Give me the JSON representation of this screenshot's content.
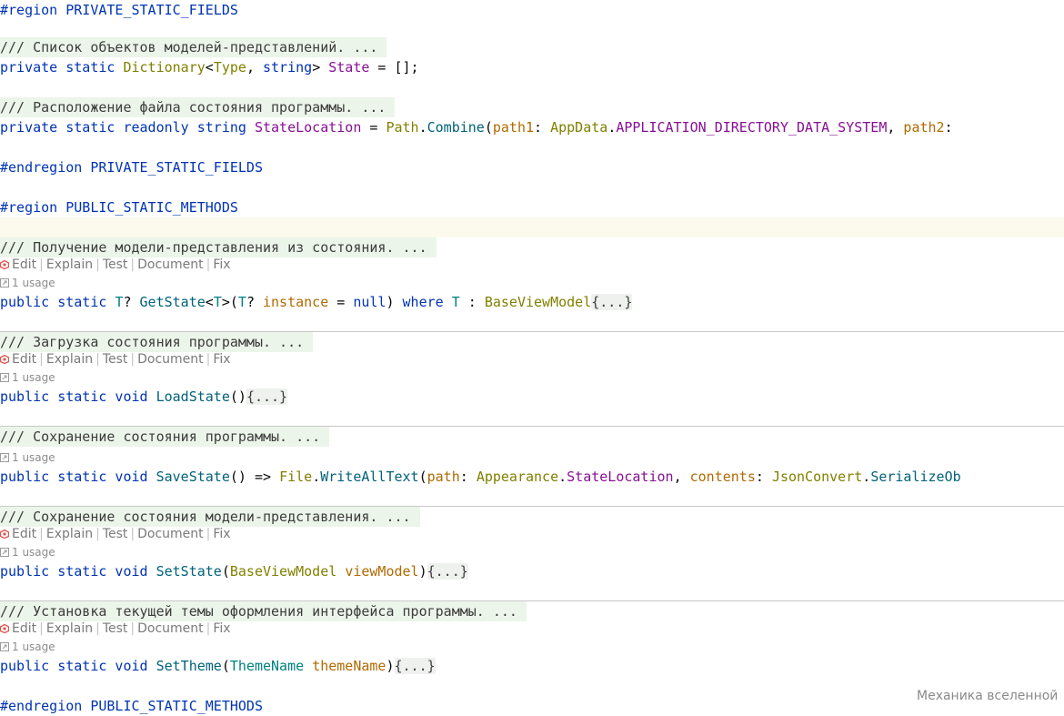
{
  "region_private": {
    "start": "#region PRIVATE_STATIC_FIELDS",
    "end": "#endregion PRIVATE_STATIC_FIELDS"
  },
  "region_public": {
    "start": "#region PUBLIC_STATIC_METHODS",
    "end": "#endregion PUBLIC_STATIC_METHODS"
  },
  "fields": [
    {
      "doc": "/// Список объектов моделей-представлений. ...",
      "tokens": [
        {
          "t": "private static ",
          "c": "kw"
        },
        {
          "t": "Dictionary",
          "c": "ty"
        },
        {
          "t": "<",
          "c": ""
        },
        {
          "t": "Type",
          "c": "ty"
        },
        {
          "t": ", ",
          "c": ""
        },
        {
          "t": "string",
          "c": "kw"
        },
        {
          "t": "> ",
          "c": ""
        },
        {
          "t": "State",
          "c": "fld"
        },
        {
          "t": " = [];",
          "c": ""
        }
      ]
    },
    {
      "doc": "/// Расположение файла состояния программы. ...",
      "tokens": [
        {
          "t": "private static readonly string ",
          "c": "kw"
        },
        {
          "t": "StateLocation",
          "c": "fld"
        },
        {
          "t": " = ",
          "c": ""
        },
        {
          "t": "Path",
          "c": "ty"
        },
        {
          "t": ".",
          "c": ""
        },
        {
          "t": "Combine",
          "c": "m"
        },
        {
          "t": "(",
          "c": ""
        },
        {
          "t": "path1",
          "c": "p"
        },
        {
          "t": ": ",
          "c": ""
        },
        {
          "t": "AppData",
          "c": "ty"
        },
        {
          "t": ".",
          "c": ""
        },
        {
          "t": "APPLICATION_DIRECTORY_DATA_SYSTEM",
          "c": "fld"
        },
        {
          "t": ", ",
          "c": ""
        },
        {
          "t": "path2",
          "c": "p"
        },
        {
          "t": ":",
          "c": ""
        }
      ]
    }
  ],
  "ai_actions": {
    "edit": "Edit",
    "explain": "Explain",
    "test": "Test",
    "document": "Document",
    "fix": "Fix"
  },
  "methods": [
    {
      "doc": "/// Получение модели-представления из состояния. ...",
      "actions": true,
      "usage": "1 usage",
      "tokens": [
        {
          "t": "public static ",
          "c": "kw"
        },
        {
          "t": "T",
          "c": "tp"
        },
        {
          "t": "? ",
          "c": ""
        },
        {
          "t": "GetState",
          "c": "m"
        },
        {
          "t": "<",
          "c": ""
        },
        {
          "t": "T",
          "c": "tp"
        },
        {
          "t": ">(",
          "c": ""
        },
        {
          "t": "T",
          "c": "tp"
        },
        {
          "t": "? ",
          "c": ""
        },
        {
          "t": "instance",
          "c": "p"
        },
        {
          "t": " = ",
          "c": ""
        },
        {
          "t": "null",
          "c": "kw"
        },
        {
          "t": ") ",
          "c": ""
        },
        {
          "t": "where ",
          "c": "kw"
        },
        {
          "t": "T",
          "c": "tp"
        },
        {
          "t": " : ",
          "c": ""
        },
        {
          "t": "BaseViewModel",
          "c": "ty"
        },
        {
          "t": "{...}",
          "c": "fold"
        }
      ]
    },
    {
      "doc": "/// Загрузка состояния программы. ...",
      "actions": true,
      "usage": "1 usage",
      "tokens": [
        {
          "t": "public static void ",
          "c": "kw"
        },
        {
          "t": "LoadState",
          "c": "m"
        },
        {
          "t": "()",
          "c": ""
        },
        {
          "t": "{...}",
          "c": "fold"
        }
      ]
    },
    {
      "doc": "/// Сохранение состояния программы. ...",
      "actions": false,
      "usage": "1 usage",
      "tokens": [
        {
          "t": "public static void ",
          "c": "kw"
        },
        {
          "t": "SaveState",
          "c": "m"
        },
        {
          "t": "() => ",
          "c": ""
        },
        {
          "t": "File",
          "c": "ty"
        },
        {
          "t": ".",
          "c": ""
        },
        {
          "t": "WriteAllText",
          "c": "m"
        },
        {
          "t": "(",
          "c": ""
        },
        {
          "t": "path",
          "c": "p"
        },
        {
          "t": ": ",
          "c": ""
        },
        {
          "t": "Appearance",
          "c": "ty"
        },
        {
          "t": ".",
          "c": ""
        },
        {
          "t": "StateLocation",
          "c": "fld"
        },
        {
          "t": ", ",
          "c": ""
        },
        {
          "t": "contents",
          "c": "p"
        },
        {
          "t": ": ",
          "c": ""
        },
        {
          "t": "JsonConvert",
          "c": "ty"
        },
        {
          "t": ".",
          "c": ""
        },
        {
          "t": "SerializeOb",
          "c": "m"
        }
      ]
    },
    {
      "doc": "/// Сохранение состояния модели-представления. ...",
      "actions": true,
      "usage": "1 usage",
      "tokens": [
        {
          "t": "public static void ",
          "c": "kw"
        },
        {
          "t": "SetState",
          "c": "m"
        },
        {
          "t": "(",
          "c": ""
        },
        {
          "t": "BaseViewModel",
          "c": "ty"
        },
        {
          "t": " ",
          "c": ""
        },
        {
          "t": "viewModel",
          "c": "p"
        },
        {
          "t": ")",
          "c": ""
        },
        {
          "t": "{...}",
          "c": "fold"
        }
      ]
    },
    {
      "doc": "/// Установка текущей темы оформления интерфейса программы. ...",
      "actions": true,
      "usage": "1 usage",
      "tokens": [
        {
          "t": "public static void ",
          "c": "kw"
        },
        {
          "t": "SetTheme",
          "c": "m"
        },
        {
          "t": "(",
          "c": ""
        },
        {
          "t": "ThemeName",
          "c": "tp"
        },
        {
          "t": " ",
          "c": ""
        },
        {
          "t": "themeName",
          "c": "p"
        },
        {
          "t": ")",
          "c": ""
        },
        {
          "t": "{...}",
          "c": "fold"
        }
      ]
    }
  ],
  "watermark": "Механика вселенной",
  "colors": {
    "keyword": "#0033b3",
    "type": "#808000",
    "type_param": "#008080",
    "field": "#871094",
    "method": "#00627a",
    "parameter": "#b06a00",
    "doc_bg": "#ecf5ea",
    "current_line": "#fcfaed"
  }
}
